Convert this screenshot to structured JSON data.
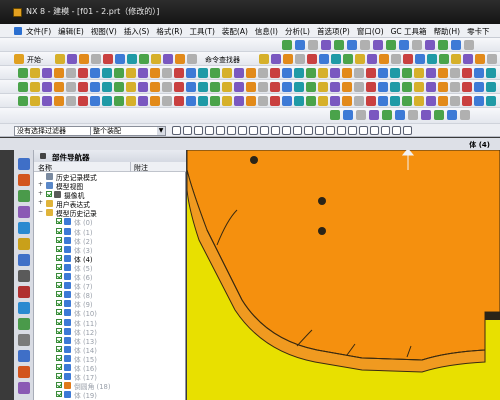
{
  "window": {
    "title": "NX 8 - 建模 - [f01 - 2.prt（修改的）]"
  },
  "menu": {
    "items": [
      "文件(F)",
      "编辑(E)",
      "视图(V)",
      "插入(S)",
      "格式(R)",
      "工具(T)",
      "装配(A)",
      "信息(I)",
      "分析(L)",
      "首选项(P)",
      "窗口(O)",
      "GC 工具箱",
      "帮助(H)",
      "零卡下"
    ]
  },
  "toolbar": {
    "start_label": "开始·",
    "command_finder_label": "命令查找器"
  },
  "filters": {
    "selection_filter": "没有选择过滤器",
    "assembly_scope": "整个装配"
  },
  "status": {
    "selection_type": "体 (4)"
  },
  "navigator": {
    "title": "部件导航器",
    "col_name": "名称",
    "col_note": "附注",
    "rows": [
      {
        "level": 1,
        "twisty": "",
        "label": "历史记录模式",
        "dim": false,
        "check": false,
        "icon": "history-icon"
      },
      {
        "level": 1,
        "twisty": "+",
        "label": "模型视图",
        "dim": false,
        "check": false,
        "icon": "views-icon"
      },
      {
        "level": 1,
        "twisty": "+",
        "label": "摄像机",
        "dim": false,
        "check": true,
        "icon": "camera-icon"
      },
      {
        "level": 1,
        "twisty": "+",
        "label": "用户表达式",
        "dim": false,
        "check": false,
        "icon": "folder-icon"
      },
      {
        "level": 1,
        "twisty": "−",
        "label": "模型历史记录",
        "dim": false,
        "check": false,
        "icon": "folder-icon"
      },
      {
        "level": 2,
        "twisty": "",
        "label": "体 (0)",
        "dim": true,
        "check": true,
        "icon": "body-icon"
      },
      {
        "level": 2,
        "twisty": "",
        "label": "体 (1)",
        "dim": true,
        "check": true,
        "icon": "body-icon"
      },
      {
        "level": 2,
        "twisty": "",
        "label": "体 (2)",
        "dim": true,
        "check": true,
        "icon": "body-icon"
      },
      {
        "level": 2,
        "twisty": "",
        "label": "体 (3)",
        "dim": true,
        "check": true,
        "icon": "body-icon"
      },
      {
        "level": 2,
        "twisty": "",
        "label": "体 (4)",
        "dim": false,
        "check": true,
        "icon": "body-icon"
      },
      {
        "level": 2,
        "twisty": "",
        "label": "体 (5)",
        "dim": true,
        "check": true,
        "icon": "body-icon"
      },
      {
        "level": 2,
        "twisty": "",
        "label": "体 (6)",
        "dim": true,
        "check": true,
        "icon": "body-icon"
      },
      {
        "level": 2,
        "twisty": "",
        "label": "体 (7)",
        "dim": true,
        "check": true,
        "icon": "body-icon"
      },
      {
        "level": 2,
        "twisty": "",
        "label": "体 (8)",
        "dim": true,
        "check": true,
        "icon": "body-icon"
      },
      {
        "level": 2,
        "twisty": "",
        "label": "体 (9)",
        "dim": true,
        "check": true,
        "icon": "body-icon"
      },
      {
        "level": 2,
        "twisty": "",
        "label": "体 (10)",
        "dim": true,
        "check": true,
        "icon": "body-icon"
      },
      {
        "level": 2,
        "twisty": "",
        "label": "体 (11)",
        "dim": true,
        "check": true,
        "icon": "body-icon"
      },
      {
        "level": 2,
        "twisty": "",
        "label": "体 (12)",
        "dim": true,
        "check": true,
        "icon": "body-icon"
      },
      {
        "level": 2,
        "twisty": "",
        "label": "体 (13)",
        "dim": true,
        "check": true,
        "icon": "body-icon"
      },
      {
        "level": 2,
        "twisty": "",
        "label": "体 (14)",
        "dim": true,
        "check": true,
        "icon": "body-icon"
      },
      {
        "level": 2,
        "twisty": "",
        "label": "体 (15)",
        "dim": true,
        "check": true,
        "icon": "body-icon"
      },
      {
        "level": 2,
        "twisty": "",
        "label": "体 (16)",
        "dim": true,
        "check": true,
        "icon": "body-icon"
      },
      {
        "level": 2,
        "twisty": "",
        "label": "体 (17)",
        "dim": true,
        "check": true,
        "icon": "body-icon"
      },
      {
        "level": 2,
        "twisty": "",
        "label": "倒圆角 (18)",
        "dim": true,
        "check": true,
        "icon": "blend-icon"
      },
      {
        "level": 2,
        "twisty": "",
        "label": "体 (19)",
        "dim": true,
        "check": true,
        "icon": "body-icon"
      }
    ]
  },
  "colors": {
    "model_top": "#f5900e",
    "model_side": "#e8e000",
    "model_edge": "#3a2a10",
    "background": "#3a3a3a"
  }
}
